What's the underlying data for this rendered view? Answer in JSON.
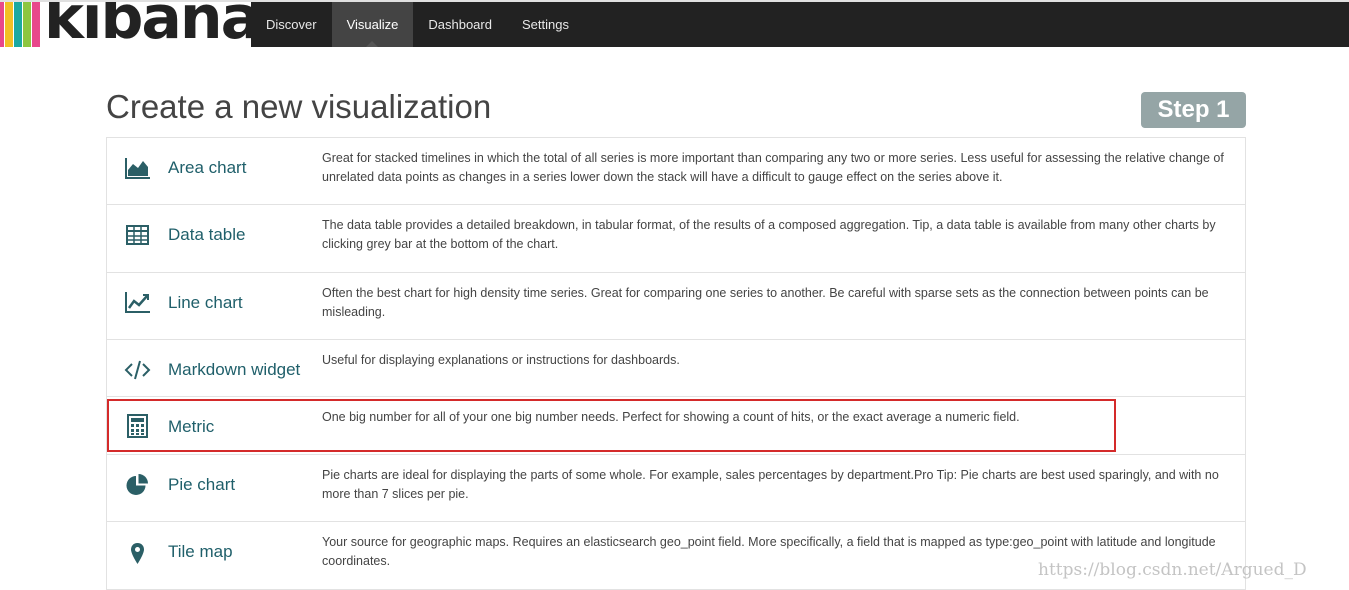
{
  "brand": {
    "name": "kibana",
    "bar_colors": [
      "#e8488b",
      "#f2c025",
      "#1ba9a1",
      "#8dc640",
      "#e8488b"
    ]
  },
  "nav": {
    "items": [
      {
        "label": "Discover",
        "active": false
      },
      {
        "label": "Visualize",
        "active": true
      },
      {
        "label": "Dashboard",
        "active": false
      },
      {
        "label": "Settings",
        "active": false
      }
    ]
  },
  "page": {
    "title": "Create a new visualization",
    "step": "Step 1"
  },
  "visualizations": [
    {
      "icon": "area-chart-icon",
      "label": "Area chart",
      "description": "Great for stacked timelines in which the total of all series is more important than comparing any two or more series. Less useful for assessing the relative change of unrelated data points as changes in a series lower down the stack will have a difficult to gauge effect on the series above it."
    },
    {
      "icon": "table-icon",
      "label": "Data table",
      "description": "The data table provides a detailed breakdown, in tabular format, of the results of a composed aggregation. Tip, a data table is available from many other charts by clicking grey bar at the bottom of the chart."
    },
    {
      "icon": "line-chart-icon",
      "label": "Line chart",
      "description": "Often the best chart for high density time series. Great for comparing one series to another. Be careful with sparse sets as the connection between points can be misleading."
    },
    {
      "icon": "code-icon",
      "label": "Markdown widget",
      "description": "Useful for displaying explanations or instructions for dashboards."
    },
    {
      "icon": "calculator-icon",
      "label": "Metric",
      "description": "One big number for all of your one big number needs. Perfect for showing a count of hits, or the exact average a numeric field.",
      "highlighted": true
    },
    {
      "icon": "pie-chart-icon",
      "label": "Pie chart",
      "description": "Pie charts are ideal for displaying the parts of some whole. For example, sales percentages by department.Pro Tip: Pie charts are best used sparingly, and with no more than 7 slices per pie."
    },
    {
      "icon": "map-marker-icon",
      "label": "Tile map",
      "description": "Your source for geographic maps. Requires an elasticsearch geo_point field. More specifically, a field that is mapped as type:geo_point with latitude and longitude coordinates."
    }
  ],
  "watermark": "https://blog.csdn.net/Argued_D",
  "colors": {
    "topbar": "#222222",
    "nav_active": "#444444",
    "link": "#1f5f6a",
    "step_badge": "#95a5a6",
    "highlight_border": "#d42a2a"
  }
}
